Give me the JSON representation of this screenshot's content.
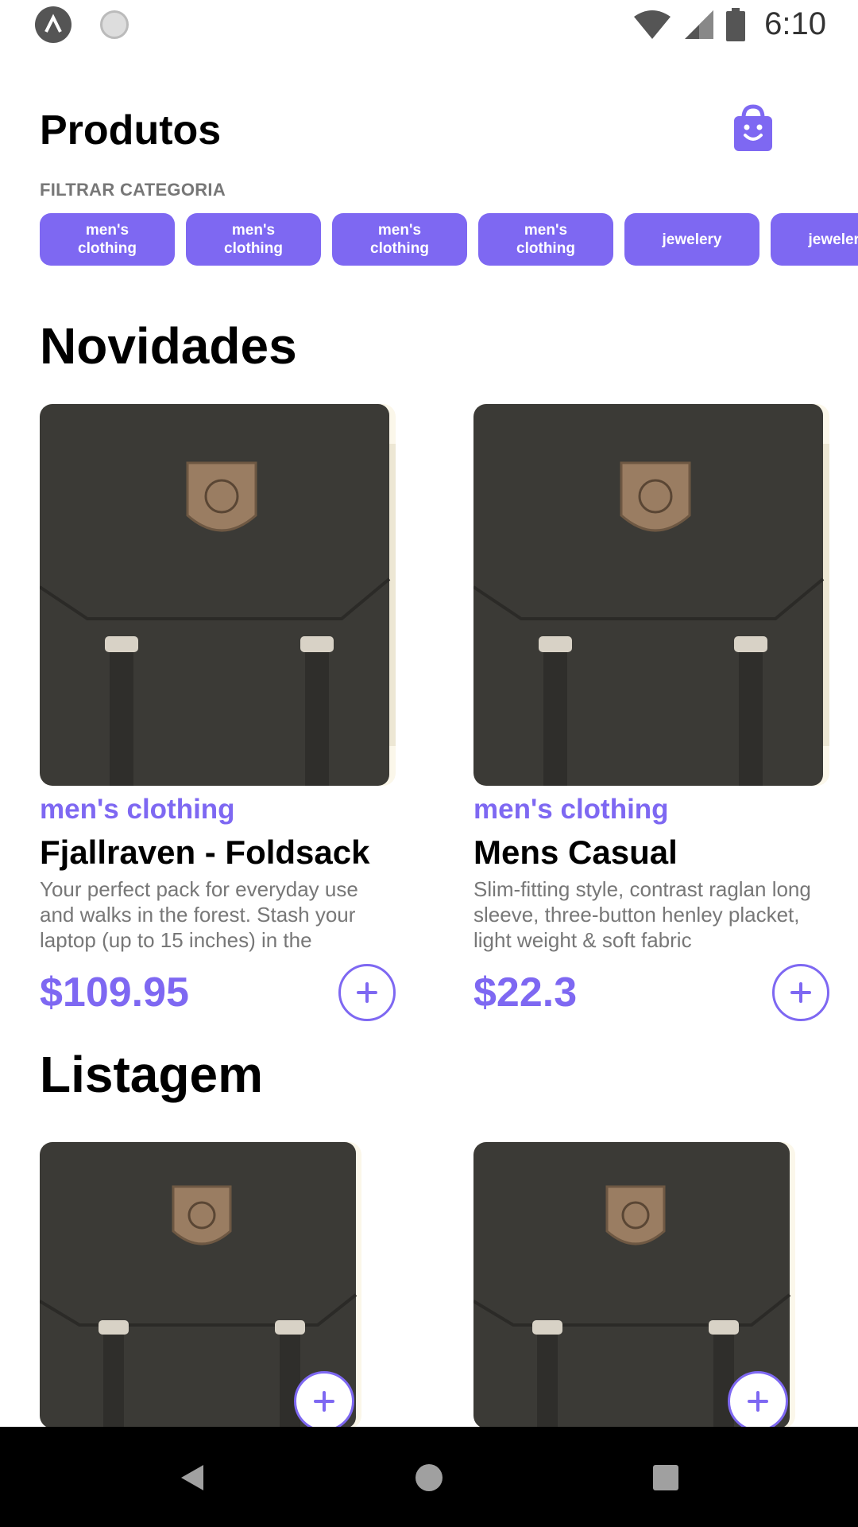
{
  "status_bar": {
    "time": "6:10"
  },
  "header": {
    "title": "Produtos",
    "cart_icon": "shopping-bag-icon"
  },
  "filter": {
    "label": "FILTRAR CATEGORIA",
    "chips": [
      {
        "line1": "men's",
        "line2": "clothing"
      },
      {
        "line1": "men's",
        "line2": "clothing"
      },
      {
        "line1": "men's",
        "line2": "clothing"
      },
      {
        "line1": "men's",
        "line2": "clothing"
      },
      {
        "line1": "jewelery",
        "line2": ""
      },
      {
        "line1": "jewelery",
        "line2": ""
      }
    ]
  },
  "news": {
    "title": "Novidades",
    "products": [
      {
        "category": "men's clothing",
        "title": "Fjallraven - Foldsack",
        "description": "Your perfect pack for everyday use and walks in the forest. Stash your laptop (up to 15 inches) in the",
        "price": "$109.95"
      },
      {
        "category": "men's clothing",
        "title": "Mens Casual",
        "description": "Slim-fitting style, contrast raglan long sleeve, three-button henley placket, light weight & soft fabric",
        "price": "$22.3"
      }
    ]
  },
  "listing": {
    "title": "Listagem"
  },
  "colors": {
    "accent": "#7e68f2",
    "muted": "#777777",
    "image_bg": "#fbf7ea",
    "bag": "#3b3a36"
  }
}
